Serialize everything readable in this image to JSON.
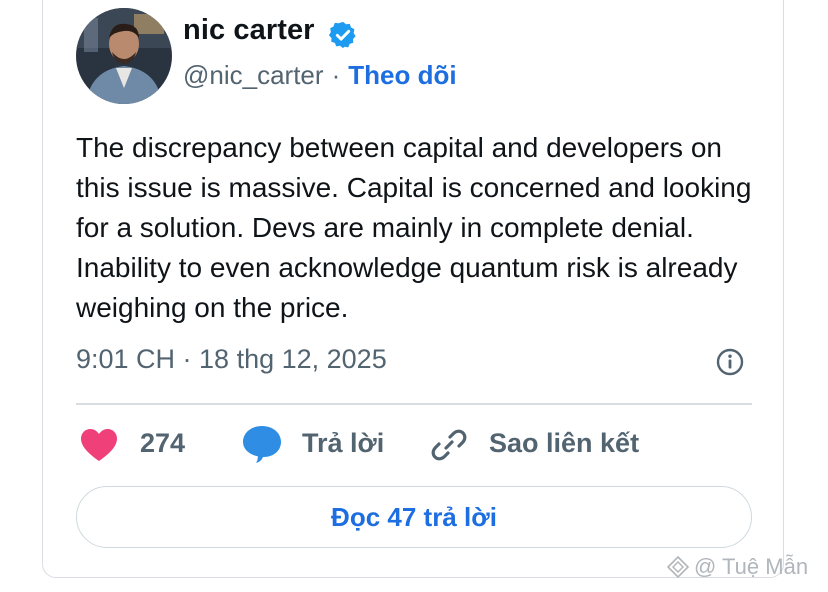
{
  "tweet": {
    "author_name": "nic carter",
    "handle": "@nic_carter",
    "separator": "·",
    "follow_label": "Theo dõi",
    "text": "The discrepancy between capital and developers on this issue is massive. Capital is concerned and looking for a solution. Devs are mainly in complete denial. Inability to even acknowledge quantum risk is already weighing on the price.",
    "timestamp": "9:01 CH · 18 thg 12, 2025"
  },
  "actions": {
    "like_count": "274",
    "reply_label": "Trả lời",
    "copy_link_label": "Sao liên kết"
  },
  "read_replies_label": "Đọc 47 trả lời",
  "watermark": "@ Tuệ Mẫn",
  "colors": {
    "link_blue": "#1d6ee0",
    "verified_blue": "#1d9bf0",
    "like_pink": "#f0407a",
    "reply_blue": "#2f8de4",
    "muted_text": "#536471"
  },
  "icons": [
    "verified-badge-icon",
    "info-icon",
    "heart-icon",
    "reply-bubble-icon",
    "link-icon",
    "watermark-logo-icon"
  ]
}
